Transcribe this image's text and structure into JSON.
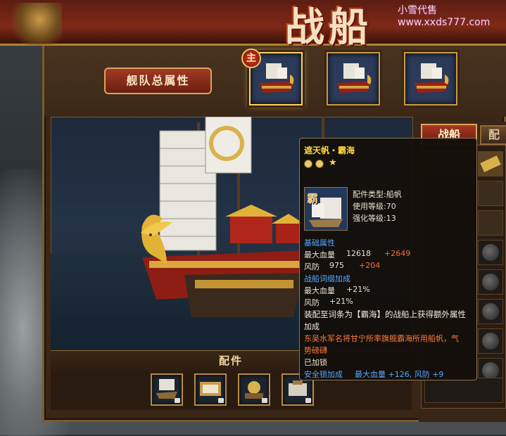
{
  "window": {
    "title": "战船",
    "watermark": "小雪代售www.xxds777.com"
  },
  "header": {
    "fleet_attributes_button": "舰队总属性",
    "main_badge": "主"
  },
  "ship_slots": [
    {
      "id": "slot-1",
      "selected": true
    },
    {
      "id": "slot-2",
      "selected": false
    },
    {
      "id": "slot-3",
      "selected": false
    }
  ],
  "parts_section": {
    "title": "配件",
    "slots": 4
  },
  "right_panel": {
    "tabs": [
      {
        "label": "战船",
        "active": true
      },
      {
        "label": "配",
        "active": false
      }
    ]
  },
  "tooltip": {
    "name": "遮天帆・霸海",
    "icon_glyph": "霸",
    "part_type": "配件类型:船帆",
    "use_level": "使用等级:70",
    "enhance_level": "强化等级:13",
    "base_attr_title": "基础属性",
    "max_hp_label": "最大血量",
    "max_hp_value": "12618",
    "max_hp_bonus": "+2649",
    "wind_def_label": "风防",
    "wind_def_value": "975",
    "wind_def_bonus": "+204",
    "affix_title": "战船词缀加成",
    "affix_hp_label": "最大血量",
    "affix_hp_value": "+21%",
    "affix_def_label": "风防",
    "affix_def_value": "+21%",
    "set_text_1": "装配至词条为【霸海】的战船上获得额外属性",
    "set_text_2": "加成",
    "lore_1": "东吴水军名将甘宁所率旗舰霸海所用船帆，气",
    "lore_2": "势磅礴",
    "locked": "已加锁",
    "lock_bonus_label": "安全锁加成",
    "lock_bonus_value": "最大血量 +126, 风防 +9"
  },
  "colors": {
    "accent_gold": "#c79a42",
    "tooltip_name": "#ffd43a",
    "section_blue": "#58a8ff",
    "bonus_red": "#ff6a3a"
  }
}
